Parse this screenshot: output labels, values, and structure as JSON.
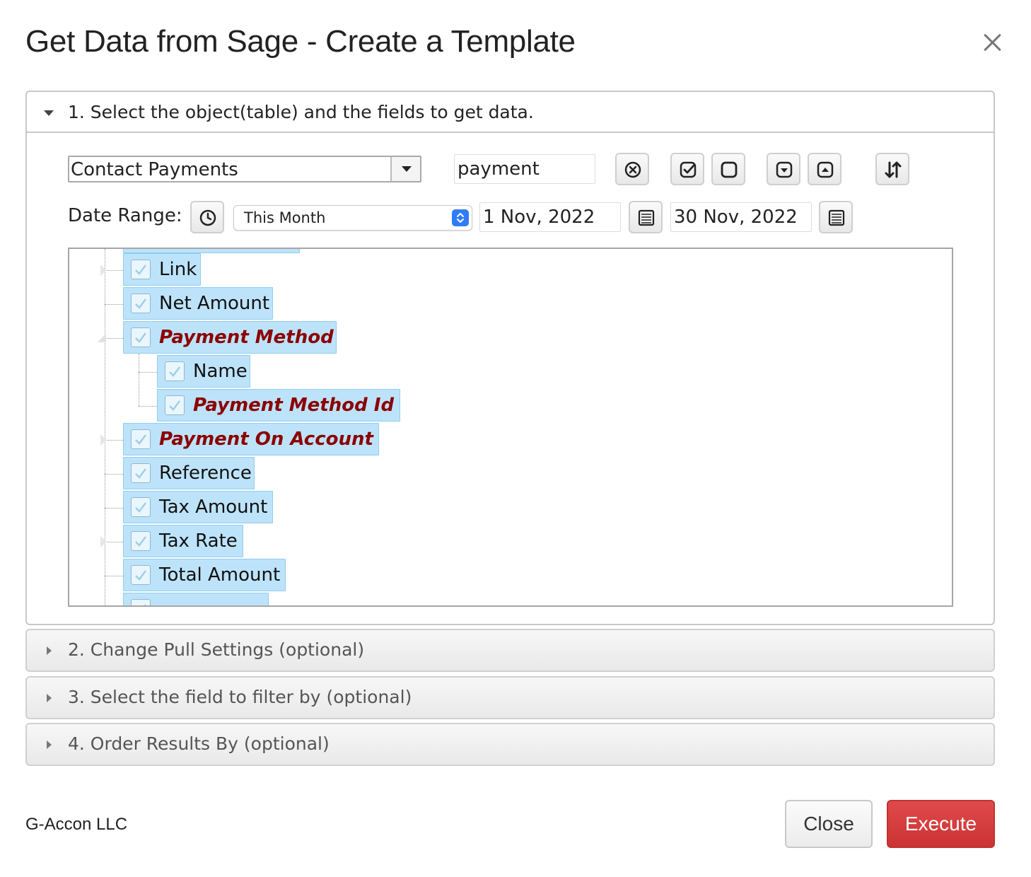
{
  "dialog": {
    "title": "Get Data from Sage - Create a Template"
  },
  "section1": {
    "header": "1. Select the object(table) and the fields to get data.",
    "object_select_value": "Contact Payments",
    "search_value": "payment",
    "date_range_label": "Date Range:",
    "period_value": "This Month",
    "date_from": "1 Nov, 2022",
    "date_to": "30 Nov, 2022",
    "tree": [
      {
        "label": "Link",
        "required": false,
        "checked": true
      },
      {
        "label": "Net Amount",
        "required": false,
        "checked": true
      },
      {
        "label": "Payment Method",
        "required": true,
        "checked": true,
        "expanded": true
      },
      {
        "label": "Name",
        "required": false,
        "checked": true
      },
      {
        "label": "Payment Method Id",
        "required": true,
        "checked": true
      },
      {
        "label": "Payment On Account",
        "required": true,
        "checked": true
      },
      {
        "label": "Reference",
        "required": false,
        "checked": true
      },
      {
        "label": "Tax Amount",
        "required": false,
        "checked": true
      },
      {
        "label": "Tax Rate",
        "required": false,
        "checked": true
      },
      {
        "label": "Total Amount",
        "required": false,
        "checked": true
      }
    ]
  },
  "section2": {
    "header": "2. Change Pull Settings (optional)"
  },
  "section3": {
    "header": "3. Select the field to filter by (optional)"
  },
  "section4": {
    "header": "4. Order Results By (optional)"
  },
  "footer": {
    "brand": "G-Accon LLC",
    "close_label": "Close",
    "execute_label": "Execute"
  },
  "colors": {
    "node_bg": "#bde3fa",
    "required_text": "#8b0000",
    "execute_bg": "#d13c3c"
  },
  "icons": {
    "clear": "clear-search-icon",
    "check_all": "check-all-icon",
    "uncheck_all": "uncheck-all-icon",
    "expand_all": "expand-all-icon",
    "collapse_all": "collapse-all-icon",
    "sort": "sort-icon",
    "period_clock": "clock-icon",
    "calendar": "calendar-icon"
  }
}
